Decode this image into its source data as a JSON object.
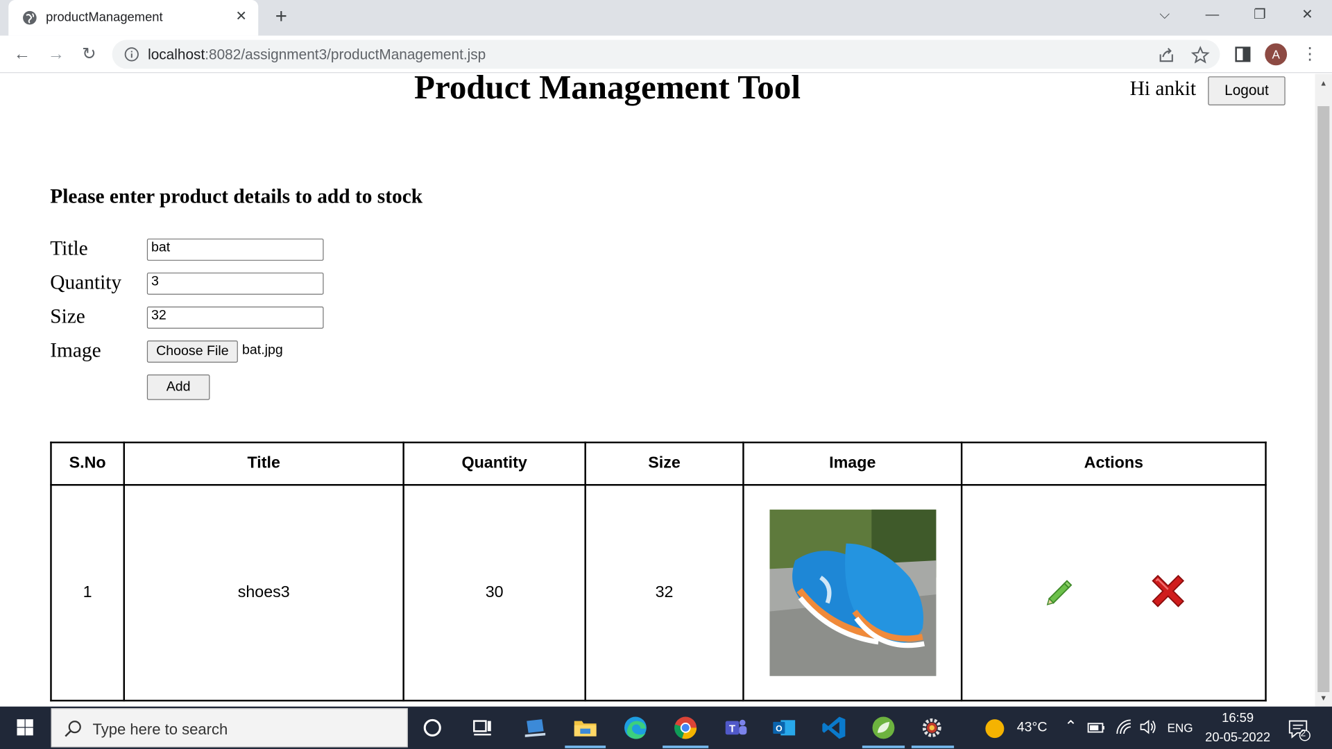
{
  "browser": {
    "tab_title": "productManagement",
    "url_host": "localhost",
    "url_path": ":8082/assignment3/productManagement.jsp",
    "avatar_letter": "A"
  },
  "page": {
    "title": "Product Management Tool",
    "greeting": "Hi ankit",
    "logout_label": "Logout"
  },
  "form": {
    "heading": "Please enter product details to add to stock",
    "title_label": "Title",
    "title_value": "bat",
    "quantity_label": "Quantity",
    "quantity_value": "3",
    "size_label": "Size",
    "size_value": "32",
    "image_label": "Image",
    "choose_file_label": "Choose File",
    "file_name": "bat.jpg",
    "add_label": "Add"
  },
  "table": {
    "headers": [
      "S.No",
      "Title",
      "Quantity",
      "Size",
      "Image",
      "Actions"
    ],
    "rows": [
      {
        "sno": "1",
        "title": "shoes3",
        "quantity": "30",
        "size": "32",
        "image": "blue-sneaker-photo"
      }
    ],
    "action_icons": [
      "edit-pencil-icon",
      "delete-x-icon"
    ]
  },
  "taskbar": {
    "search_placeholder": "Type here to search",
    "temperature": "43°C",
    "language": "ENG",
    "time": "16:59",
    "date": "20-05-2022",
    "notification_count": "2"
  },
  "colors": {
    "tabstrip": "#dee1e6",
    "taskbar": "#202838",
    "table_border": "#000000",
    "delete_icon": "#d01c1c",
    "edit_icon": "#6cc04a"
  }
}
